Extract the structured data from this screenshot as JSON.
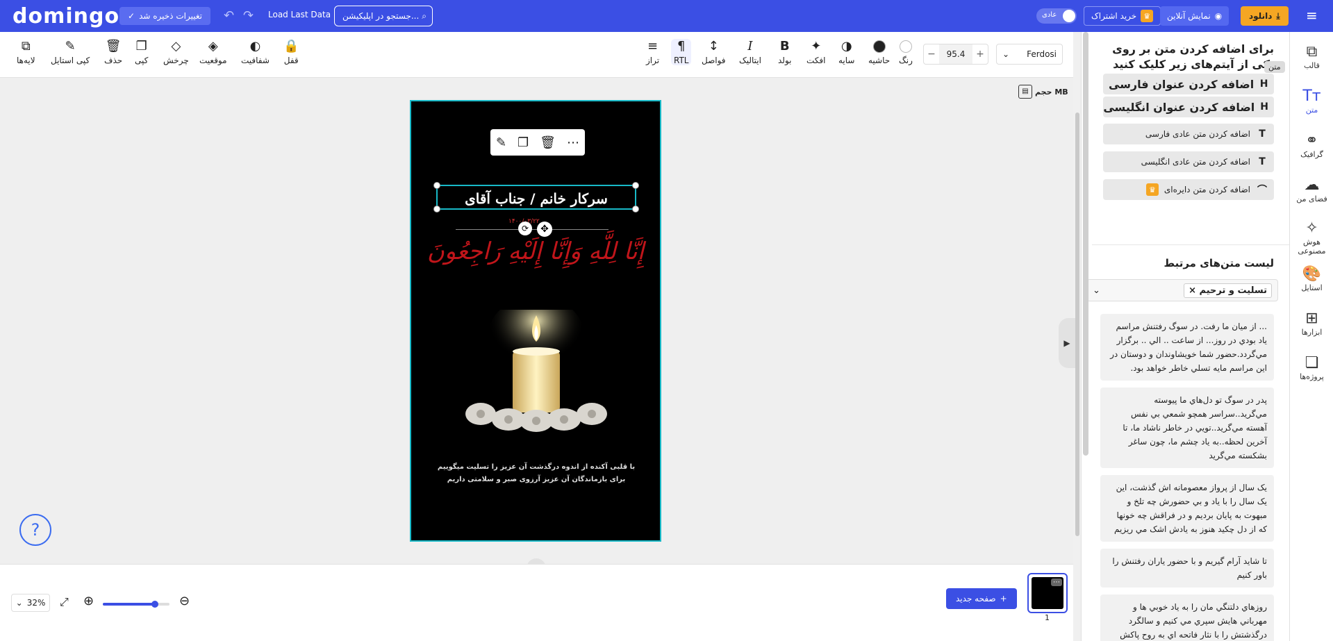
{
  "topbar": {
    "logo": "domingo",
    "save_status": "تغییرات ذخیره شد",
    "undo_icon": "↶",
    "redo_icon": "↷",
    "load_last": "Load Last Data",
    "search_placeholder": "جستجو در اپلیکیشن...",
    "mode_label": "عادی",
    "subscribe": "خرید اشتراک",
    "online_view": "نمایش آنلاین",
    "download": "دانلود",
    "menu_icon": "≡"
  },
  "toolbar": {
    "left": [
      {
        "icon": "⧉",
        "label": "لایه‌ها"
      },
      {
        "icon": "✎",
        "label": "کپی استایل"
      },
      {
        "icon": "🗑",
        "label": "حذف"
      },
      {
        "icon": "❐",
        "label": "کپی"
      },
      {
        "icon": "◇",
        "label": "چرخش"
      },
      {
        "icon": "◈",
        "label": "موقعیت"
      },
      {
        "icon": "◐",
        "label": "شفافیت"
      },
      {
        "icon": "🔒",
        "label": "قفل"
      }
    ],
    "right": [
      {
        "icon": "≡",
        "label": "تراز"
      },
      {
        "icon": "¶",
        "label": "RTL"
      },
      {
        "icon": "↕",
        "label": "فواصل"
      },
      {
        "icon": "I",
        "label": "ایتالیک"
      },
      {
        "icon": "B",
        "label": "بولد"
      },
      {
        "icon": "✦",
        "label": "افکت"
      },
      {
        "icon": "◑",
        "label": "سایه"
      }
    ],
    "stroke_label": "حاشیه",
    "color_label": "رنگ",
    "font_size": "95.4",
    "minus": "−",
    "plus": "+",
    "font_name": "Ferdosi",
    "chevron": "⌄"
  },
  "canvas": {
    "size_label": "حجم MB",
    "title": "سرکار خانم / جناب آقای",
    "date": "۱۴۰۰/۰۳/۲۲",
    "verse": "إِنَّا لِلَّهِ وَإِنَّا إِلَيْهِ رَاجِعُونَ",
    "body_line1": "با قلبی آکنده از اندوه درگذشت آن عزیز را تسلیت میگوییم",
    "body_line2": "برای بازماندگان آن عزیز آرزوی صبر و سلامتی داریم",
    "ctx_icons": [
      "✎",
      "❐",
      "🗑",
      "⋯"
    ],
    "rotate_icon": "⟳",
    "move_icon": "✥",
    "collapse_right": "▶",
    "collapse_bottom": "⌄",
    "help": "?"
  },
  "bottombar": {
    "zoom": "32%",
    "chevron": "⌄",
    "fit_icon": "⤢",
    "zoom_in_icon": "⊕",
    "zoom_out_icon": "⊖",
    "zoom_level": 0.78,
    "new_page": "صفحه جدید",
    "page_number": "1",
    "thumb_dots": "⋯"
  },
  "panel": {
    "heading": "برای اضافه کردن متن بر روی یکی از آیتم‌های زیر کلیک کنید",
    "add_buttons": [
      {
        "icon": "H",
        "label": "اضافه کردن عنوان فارسی"
      },
      {
        "icon": "H",
        "label": "اضافه کردن عنوان انگلیسی"
      },
      {
        "icon": "T",
        "label": "اضافه کردن متن عادی فارسی"
      },
      {
        "icon": "T",
        "label": "اضافه کردن متن عادی انگلیسی"
      },
      {
        "icon": "⌒",
        "label": "اضافه کردن متن دایره‌ای"
      }
    ],
    "related_title": "لیست متن‌های مرتبط",
    "filter_chip": "تسلیت و ترحیم",
    "cards": [
      "... از میان ما رفت. در سوگ رفتنش مراسم یاد بودي در روز... از ساعت .. الي .. برگزار مي‌گردد.حضور شما خویشاوندان و دوستان در این مراسم مایه تسلي خاطر خواهد بود.",
      "پدر در سوگ تو دل‌هاي ما پیوسته مي‌گرید..سراسر همچو شمعي بي نفس آهسته مي‌گرید..تويي در خاطر ناشاد ما، تا آخرین لحظه..به یاد چشم ما، چون ساغر بشکسته مي‌گرید",
      "یک سال از پرواز معصومانه اش گذشت، این یک سال را با یاد و بي حضورش چه تلخ و مبهوت به پایان بردیم و در فراقش چه خونها که از دل چکید هنوز به یادش اشک مي ریزیم",
      "تا شاید آرام گیریم و با حضور یاران رفتنش را باور کنیم",
      "روزهاي دلتنگي مان را به یاد خوبي ها و مهرباني هایش سپري مي کنیم و سالگرد درگذشتش را با نثار فاتحه اي به روح پاکش"
    ]
  },
  "sidebar": {
    "items": [
      {
        "icon": "⧉",
        "label": "قالب"
      },
      {
        "icon": "Tт",
        "label": "متن"
      },
      {
        "icon": "⚭",
        "label": "گرافیک"
      },
      {
        "icon": "☁",
        "label": "فضای من"
      },
      {
        "icon": "✧",
        "label": "هوش مصنوعی"
      },
      {
        "icon": "🎨",
        "label": "استایل"
      },
      {
        "icon": "⊞",
        "label": "ابزارها"
      },
      {
        "icon": "❏",
        "label": "پروژه‌ها"
      }
    ],
    "tooltip": "متن"
  },
  "colors": {
    "brand": "#3b4fe4",
    "accent": "#f5a623",
    "selection": "#18b9c7"
  }
}
